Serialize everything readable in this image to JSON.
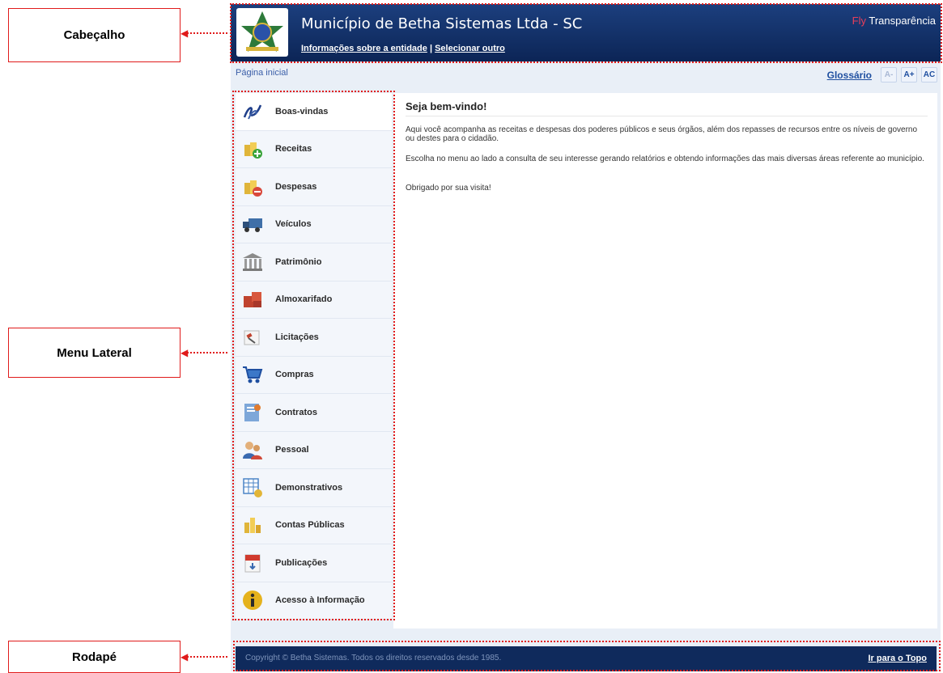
{
  "annotations": {
    "header": "Cabeçalho",
    "sidebar": "Menu Lateral",
    "footer": "Rodapé"
  },
  "header": {
    "title": "Município de Betha Sistemas Ltda - SC",
    "link_info": "Informações sobre a entidade",
    "separator": "|",
    "link_select": "Selecionar outro",
    "brand_fly": "Fly",
    "brand_name": "Transparência"
  },
  "toolbar": {
    "breadcrumb": "Página inicial",
    "glossary": "Glossário",
    "font_decrease": "A-",
    "font_increase": "A+",
    "contrast": "AC"
  },
  "menu": {
    "items": [
      {
        "label": "Boas-vindas",
        "icon": "swirl-icon"
      },
      {
        "label": "Receitas",
        "icon": "coins-plus-icon"
      },
      {
        "label": "Despesas",
        "icon": "coins-minus-icon"
      },
      {
        "label": "Veículos",
        "icon": "truck-icon"
      },
      {
        "label": "Patrimônio",
        "icon": "building-icon"
      },
      {
        "label": "Almoxarifado",
        "icon": "boxes-icon"
      },
      {
        "label": "Licitações",
        "icon": "gavel-icon"
      },
      {
        "label": "Compras",
        "icon": "cart-icon"
      },
      {
        "label": "Contratos",
        "icon": "contract-icon"
      },
      {
        "label": "Pessoal",
        "icon": "people-icon"
      },
      {
        "label": "Demonstrativos",
        "icon": "spreadsheet-icon"
      },
      {
        "label": "Contas Públicas",
        "icon": "coin-stacks-icon"
      },
      {
        "label": "Publicações",
        "icon": "pdf-icon"
      },
      {
        "label": "Acesso à Informação",
        "icon": "info-icon"
      }
    ]
  },
  "content": {
    "title": "Seja bem-vindo!",
    "p1": "Aqui você acompanha as receitas e despesas dos poderes públicos e seus órgãos, além dos repasses de recursos entre os níveis de governo ou destes para o cidadão.",
    "p2": "Escolha no menu ao lado a consulta de seu interesse gerando relatórios e obtendo informações das mais diversas áreas referente ao município.",
    "p3": "Obrigado por sua visita!"
  },
  "footer": {
    "copyright": "Copyright © Betha Sistemas. Todos os direitos reservados desde 1985.",
    "back_to_top": "Ir para o Topo"
  },
  "colors": {
    "header_bg": "#0c2556",
    "annotation_red": "#e01b1b",
    "brand_fly": "#e83e5a",
    "footer_bg": "#0f2a5c"
  }
}
